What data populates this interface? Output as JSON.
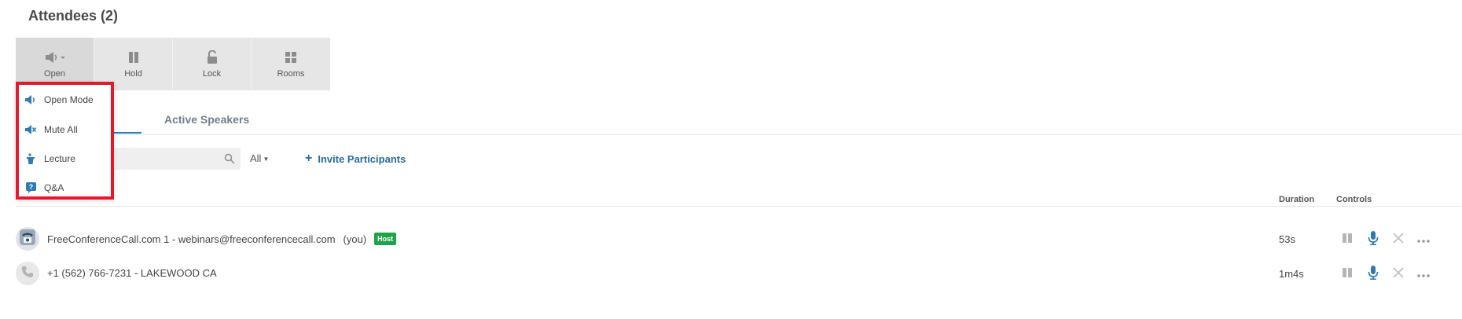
{
  "header": {
    "title": "Attendees (2)"
  },
  "toolbar": {
    "buttons": [
      {
        "label": "Open",
        "icon": "speaker-icon"
      },
      {
        "label": "Hold",
        "icon": "pause-icon"
      },
      {
        "label": "Lock",
        "icon": "unlock-icon"
      },
      {
        "label": "Rooms",
        "icon": "grid-icon"
      }
    ]
  },
  "mode_menu": {
    "items": [
      {
        "label": "Open Mode",
        "icon": "speaker-icon"
      },
      {
        "label": "Mute All",
        "icon": "speaker-muted-icon"
      },
      {
        "label": "Lecture",
        "icon": "podium-icon"
      },
      {
        "label": "Q&A",
        "icon": "question-bubble-icon"
      }
    ]
  },
  "tabs": [
    {
      "label": "Active Speakers"
    }
  ],
  "filters": {
    "search_placeholder": "",
    "filter_value": "All",
    "invite_label": "Invite Participants"
  },
  "table": {
    "columns": {
      "duration": "Duration",
      "controls": "Controls"
    },
    "rows": [
      {
        "name": "FreeConferenceCall.com 1 - webinars@freeconferencecall.com",
        "suffix": "(you)",
        "badge": "Host",
        "duration": "53s",
        "avatar": "desk-phone-icon"
      },
      {
        "name": "+1 (562) 766-7231 - LAKEWOOD CA",
        "duration": "1m4s",
        "avatar": "phone-handset-icon"
      }
    ]
  },
  "colors": {
    "accent": "#2d7ab4",
    "highlight_border": "#e11b2b",
    "host_badge": "#1fa34a",
    "toolbar_bg": "#e6e6e6"
  }
}
